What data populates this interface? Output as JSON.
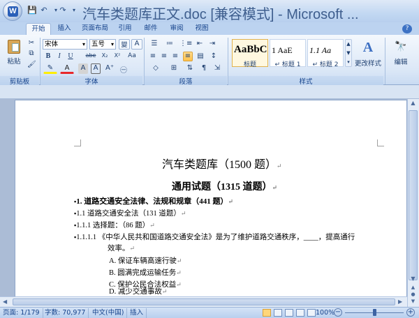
{
  "window": {
    "title": "汽车类题库正文.doc [兼容模式] - Microsoft ..."
  },
  "quick_access": {
    "save_icon": "save-icon",
    "undo_icon": "undo-icon",
    "redo_icon": "redo-icon"
  },
  "tabs": [
    {
      "label": "开始"
    },
    {
      "label": "插入"
    },
    {
      "label": "页面布局"
    },
    {
      "label": "引用"
    },
    {
      "label": "邮件"
    },
    {
      "label": "审阅"
    },
    {
      "label": "视图"
    }
  ],
  "ribbon": {
    "clipboard": {
      "paste_label": "粘贴",
      "group_label": "剪贴板"
    },
    "font": {
      "font_name": "宋体",
      "font_size": "五号",
      "group_label": "字体",
      "wen": "變",
      "a_label": "A",
      "bold": "B",
      "italic": "I",
      "underline": "U",
      "strike": "abe",
      "sub": "X₂",
      "sup": "X²",
      "aa": "Aa"
    },
    "paragraph": {
      "group_label": "段落"
    },
    "styles": {
      "group_label": "样式",
      "items": [
        {
          "sample": "AaBbC",
          "label": "标题"
        },
        {
          "sample": "1    AaE",
          "label": "↵ 标题 1"
        },
        {
          "sample": "1.1  Aa",
          "label": "↵ 标题 2"
        }
      ],
      "change_label": "更改样式",
      "edit_label": "编辑"
    }
  },
  "document": {
    "title": "汽车类题库（1500 题）",
    "subtitle": "通用试题（1315 道题）",
    "lines": [
      {
        "marker": "▪",
        "text": "1.  道路交通安全法律、法规和规章（441 题）"
      },
      {
        "marker": "▪",
        "text": "1.1 道路交通安全法（131 道题）"
      },
      {
        "marker": "▪",
        "text": "1.1.1 选择题：（86 题）"
      },
      {
        "marker": "▪",
        "text": "1.1.1.1  《中华人民共和国道路交通安全法》是为了维护道路交通秩序，____，提高通行"
      },
      {
        "marker": "",
        "text": "效率。"
      },
      {
        "marker": "",
        "text": "A. 保证车辆高速行驶"
      },
      {
        "marker": "",
        "text": "B. 圆满完成运输任务"
      },
      {
        "marker": "",
        "text": "C. 保护公民合法权益"
      },
      {
        "marker": "",
        "text": "D. 减少交通事故"
      }
    ],
    "return_mark": "↵"
  },
  "status": {
    "page": "页面: 1/179",
    "words": "字数: 70,977",
    "language": "中文(中国)",
    "mode": "插入",
    "zoom": "100%"
  }
}
